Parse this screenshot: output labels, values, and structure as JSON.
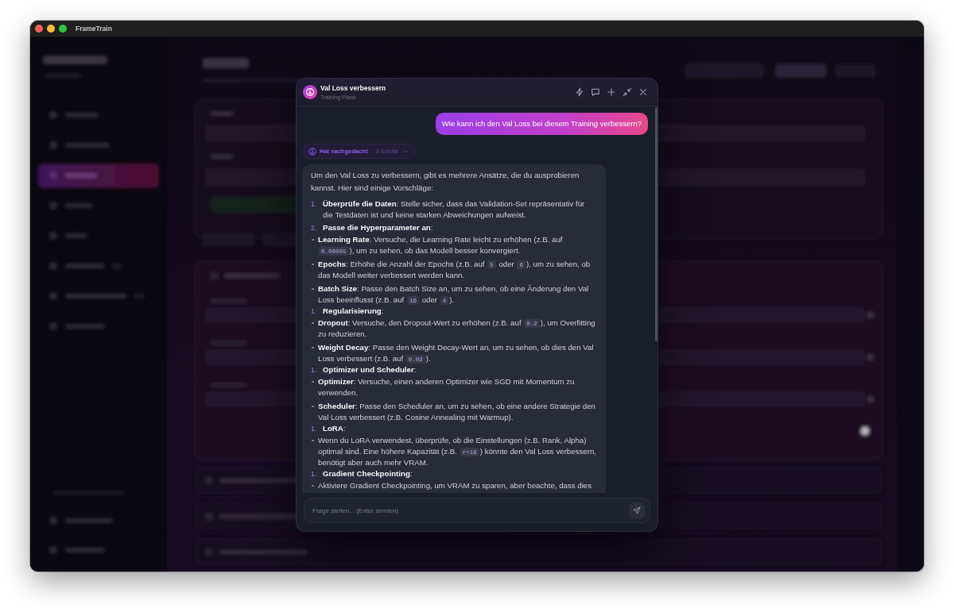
{
  "window": {
    "title": "FrameTrain"
  },
  "backdrop": {
    "kind": "blurred-app",
    "nav": [
      {
        "selected": false
      },
      {
        "selected": false
      },
      {
        "selected": true
      },
      {
        "selected": false
      },
      {
        "selected": false
      },
      {
        "selected": false
      },
      {
        "selected": false
      },
      {
        "selected": false
      },
      {
        "selected": false
      },
      {
        "selected": false
      }
    ]
  },
  "chat": {
    "title": "Val Loss verbessern",
    "subtitle": "Training Panel",
    "messages": [
      {
        "kind": "user",
        "text": "Wie kann ich den Val Loss bei diesem Training verbessern?"
      },
      {
        "kind": "assistant",
        "thinking": {
          "label": "Hat nachgedacht",
          "steps": "3 Schritte",
          "expanded": false
        },
        "blocks": [
          {
            "kind": "paragraph",
            "parts": [
              {
                "kind": "text",
                "text": "Um den Val Loss zu verbessern, gibt es mehrere Ansätze, die du ausprobieren kannst. Hier sind einige Vorschläge:"
              }
            ]
          },
          {
            "kind": "numbered",
            "marker": "1.",
            "parts": [
              {
                "kind": "text",
                "text": "**Überprüfe die Daten**: Stelle sicher, dass das Validation-Set repräsentativ für die Testdaten ist und keine starken Abweichungen aufweist."
              }
            ]
          },
          {
            "kind": "numbered",
            "marker": "2.",
            "parts": [
              {
                "kind": "text",
                "text": "**Passe die Hyperparameter an**:"
              }
            ]
          },
          {
            "kind": "bullet",
            "parts": [
              {
                "kind": "text",
                "text": "**Learning Rate**: Versuche, die Learning Rate leicht zu erhöhen (z.B. auf "
              },
              {
                "kind": "code",
                "text": "0.00005"
              },
              {
                "kind": "text",
                "text": "), um zu sehen, ob das Modell besser konvergiert."
              }
            ]
          },
          {
            "kind": "bullet",
            "parts": [
              {
                "kind": "text",
                "text": "**Epochs**: Erhöhe die Anzahl der Epochs (z.B. auf "
              },
              {
                "kind": "code",
                "text": "5"
              },
              {
                "kind": "text",
                "text": " oder "
              },
              {
                "kind": "code",
                "text": "6"
              },
              {
                "kind": "text",
                "text": "), um zu sehen, ob das Modell weiter verbessert werden kann."
              }
            ]
          },
          {
            "kind": "bullet",
            "parts": [
              {
                "kind": "text",
                "text": "**Batch Size**: Passe den Batch Size an, um zu sehen, ob eine Änderung den Val Loss beeinflusst (z.B. auf "
              },
              {
                "kind": "code",
                "text": "16"
              },
              {
                "kind": "text",
                "text": " oder "
              },
              {
                "kind": "code",
                "text": "4"
              },
              {
                "kind": "text",
                "text": ")."
              }
            ]
          },
          {
            "kind": "numbered",
            "marker": "1.",
            "parts": [
              {
                "kind": "text",
                "text": "**Regularisierung**:"
              }
            ]
          },
          {
            "kind": "bullet",
            "parts": [
              {
                "kind": "text",
                "text": "**Dropout**: Versuche, den Dropout-Wert zu erhöhen (z.B. auf "
              },
              {
                "kind": "code",
                "text": "0.2"
              },
              {
                "kind": "text",
                "text": "), um Overfitting zu reduzieren."
              }
            ]
          },
          {
            "kind": "bullet",
            "parts": [
              {
                "kind": "text",
                "text": "**Weight Decay**: Passe den Weight Decay-Wert an, um zu sehen, ob dies den Val Loss verbessert (z.B. auf "
              },
              {
                "kind": "code",
                "text": "0.02"
              },
              {
                "kind": "text",
                "text": ")."
              }
            ]
          },
          {
            "kind": "numbered",
            "marker": "1.",
            "parts": [
              {
                "kind": "text",
                "text": "**Optimizer und Scheduler**:"
              }
            ]
          },
          {
            "kind": "bullet",
            "parts": [
              {
                "kind": "text",
                "text": "**Optimizer**: Versuche, einen anderen Optimizer wie SGD mit Momentum zu verwenden."
              }
            ]
          },
          {
            "kind": "bullet",
            "parts": [
              {
                "kind": "text",
                "text": "**Scheduler**: Passe den Scheduler an, um zu sehen, ob eine andere Strategie den Val Loss verbessert (z.B. Cosine Annealing mit Warmup)."
              }
            ]
          },
          {
            "kind": "numbered",
            "marker": "1.",
            "parts": [
              {
                "kind": "text",
                "text": "**LoRA**:"
              }
            ]
          },
          {
            "kind": "bullet",
            "parts": [
              {
                "kind": "text",
                "text": "Wenn du LoRA verwendest, überprüfe, ob die Einstellungen (z.B. Rank, Alpha) optimal sind. Eine höhere Kapazität (z.B. "
              },
              {
                "kind": "code",
                "text": "r=16"
              },
              {
                "kind": "text",
                "text": ") könnte den Val Loss verbessern, benötigt aber auch mehr VRAM."
              }
            ]
          },
          {
            "kind": "numbered",
            "marker": "1.",
            "parts": [
              {
                "kind": "text",
                "text": "**Gradient Checkpointing**:"
              }
            ]
          },
          {
            "kind": "bullet",
            "parts": [
              {
                "kind": "text",
                "text": "Aktiviere Gradient Checkpointing, um VRAM zu sparen, aber beachte, dass dies"
              }
            ]
          }
        ]
      }
    ],
    "input": {
      "placeholder": "Frage stellen... (Enter senden)"
    }
  }
}
